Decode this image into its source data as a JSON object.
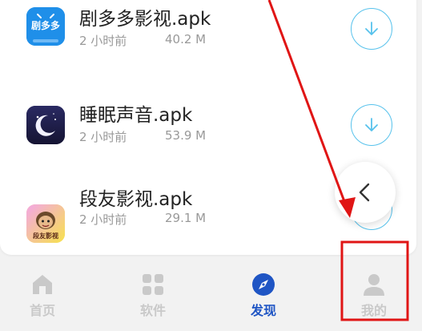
{
  "apps": [
    {
      "name": "剧多多影视.apk",
      "time": "2 小时前",
      "size": "40.2 M",
      "icon": "juduoduo-app-icon",
      "icon_text": "剧多多",
      "icon_bg": "#1f8fe9"
    },
    {
      "name": "睡眠声音.apk",
      "time": "2 小时前",
      "size": "53.9 M",
      "icon": "moon-app-icon",
      "icon_bg": "#1e1c49"
    },
    {
      "name": "段友影视.apk",
      "time": "2 小时前",
      "size": "29.1 M",
      "icon": "duanyou-app-icon",
      "icon_text": "段友影视",
      "icon_bg": "#f5d84b"
    }
  ],
  "nav": [
    {
      "label": "首页",
      "icon": "home-icon",
      "active": false
    },
    {
      "label": "软件",
      "icon": "grid-icon",
      "active": false
    },
    {
      "label": "发现",
      "icon": "compass-icon",
      "active": true
    },
    {
      "label": "我的",
      "icon": "user-icon",
      "active": false
    }
  ],
  "colors": {
    "accent": "#1f55c4",
    "download_ring": "#57c2ec",
    "annotation": "#e01515",
    "inactive": "#c9c9c9"
  }
}
